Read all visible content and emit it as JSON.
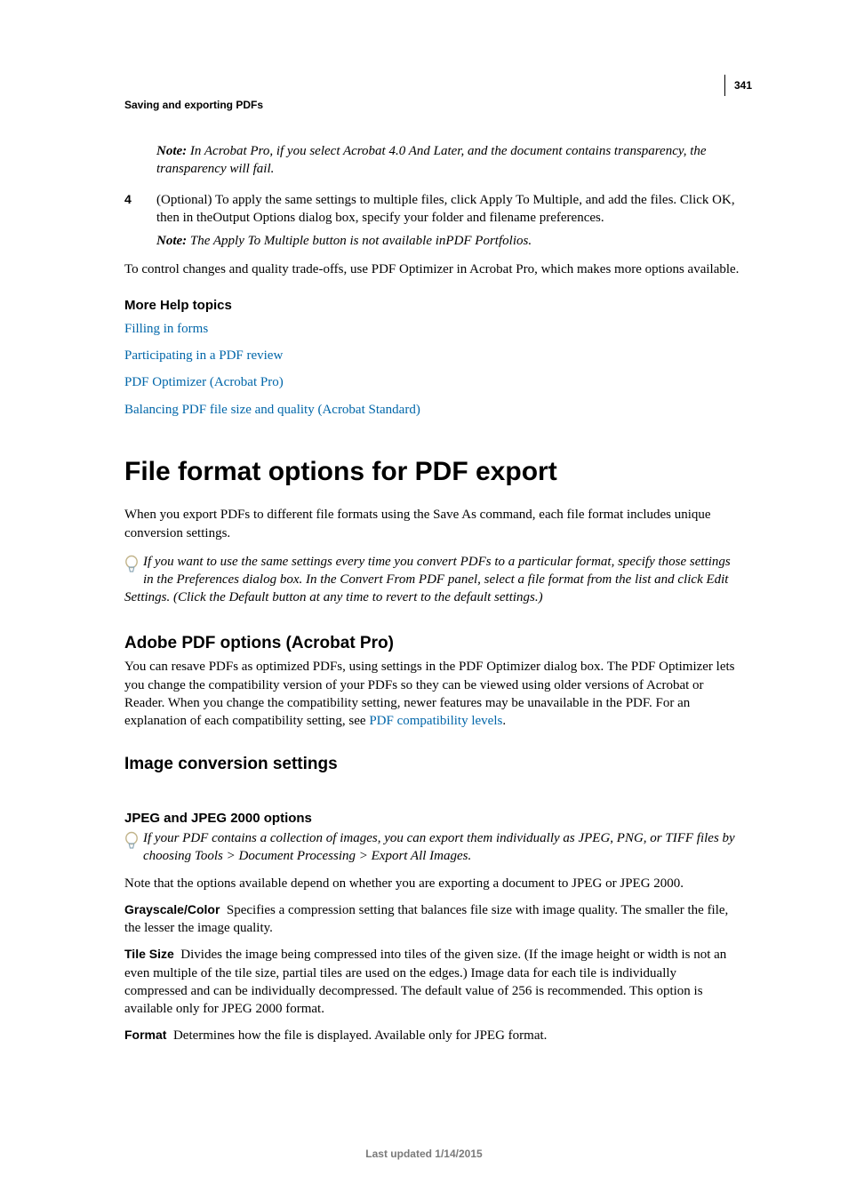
{
  "page_number": "341",
  "section_header": "Saving and exporting PDFs",
  "note1_label": "Note:",
  "note1_text": " In Acrobat Pro, if you select Acrobat 4.0 And Later, and the document contains transparency, the transparency will fail.",
  "step4_num": "4",
  "step4_text": "(Optional) To apply the same settings to multiple files, click Apply To Multiple, and add the files. Click OK, then in theOutput Options dialog box, specify your folder and filename preferences.",
  "note2_label": "Note:",
  "note2_text": " The Apply To Multiple button is not available inPDF Portfolios.",
  "para1": "To control changes and quality trade-offs, use PDF Optimizer in Acrobat Pro, which makes more options available.",
  "more_help": "More Help topics",
  "links": {
    "l1": "Filling in forms",
    "l2": "Participating in a PDF review",
    "l3": "PDF Optimizer (Acrobat Pro)",
    "l4": "Balancing PDF file size and quality (Acrobat Standard)"
  },
  "h1": "File format options for PDF export",
  "intro": "When you export PDFs to different file formats using the Save As command, each file format includes unique conversion settings.",
  "tip1": "If you want to use the same settings every time you convert PDFs to a particular format, specify those settings in the Preferences dialog box. In the Convert From PDF panel, select a file format from the list and click Edit Settings. (Click the Default button at any time to revert to the default settings.)",
  "h2_adobe": "Adobe PDF options (Acrobat Pro)",
  "adobe_body_a": "You can resave PDFs as optimized PDFs, using settings in the PDF Optimizer dialog box. The PDF Optimizer lets you change the compatibility version of your PDFs so they can be viewed using older versions of Acrobat or Reader. When you change the compatibility setting, newer features may be unavailable in the PDF. For an explanation of each compatibility setting, see ",
  "adobe_link": "PDF compatibility levels",
  "adobe_body_b": ".",
  "h2_image": "Image conversion settings",
  "h3_jpeg": "JPEG and JPEG 2000 options",
  "tip2": "If your PDF contains a collection of images, you can export them individually as JPEG, PNG, or TIFF files by choosing Tools > Document Processing > Export All Images.",
  "jpeg_note": "Note that the options available depend on whether you are exporting a document to JPEG or JPEG 2000.",
  "opt_gray_term": "Grayscale/Color",
  "opt_gray_def": "Specifies a compression setting that balances file size with image quality. The smaller the file, the lesser the image quality.",
  "opt_tile_term": "Tile Size",
  "opt_tile_def": "Divides the image being compressed into tiles of the given size. (If the image height or width is not an even multiple of the tile size, partial tiles are used on the edges.) Image data for each tile is individually compressed and can be individually decompressed. The default value of 256 is recommended. This option is available only for JPEG 2000 format.",
  "opt_format_term": "Format",
  "opt_format_def": "Determines how the file is displayed. Available only for JPEG format.",
  "footer": "Last updated 1/14/2015"
}
